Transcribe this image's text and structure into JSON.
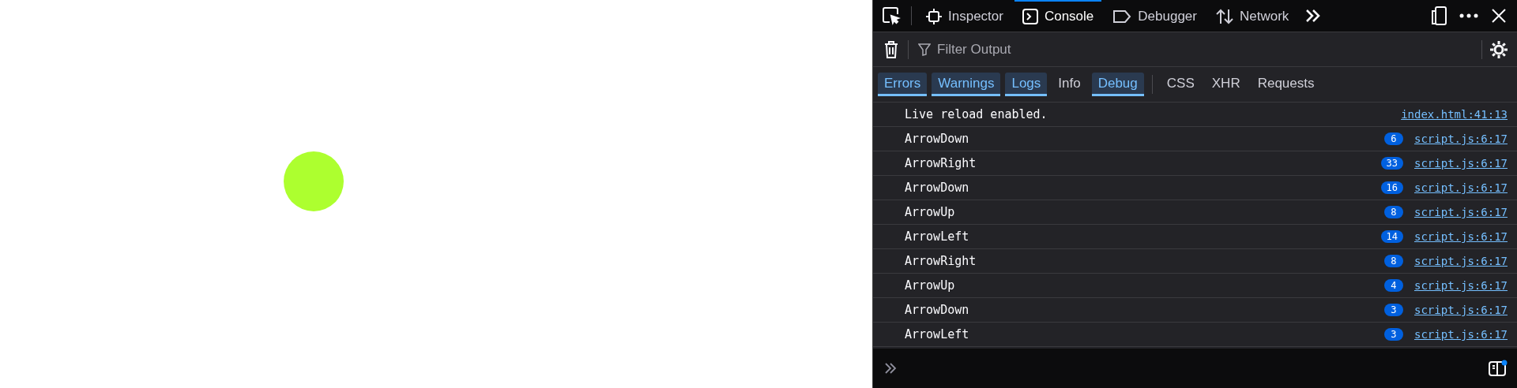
{
  "page": {
    "ball": {
      "color": "#adff2f"
    }
  },
  "devtools": {
    "tabs": [
      {
        "label": "Inspector",
        "kind": "inspector",
        "selected": false
      },
      {
        "label": "Console",
        "kind": "console",
        "selected": true
      },
      {
        "label": "Debugger",
        "kind": "debugger",
        "selected": false
      },
      {
        "label": "Network",
        "kind": "network",
        "selected": false
      }
    ],
    "filter": {
      "placeholder": "Filter Output"
    },
    "levels": [
      {
        "label": "Errors",
        "selected": true
      },
      {
        "label": "Warnings",
        "selected": true
      },
      {
        "label": "Logs",
        "selected": true
      },
      {
        "label": "Info",
        "selected": false
      },
      {
        "label": "Debug",
        "selected": true
      }
    ],
    "categories": [
      {
        "label": "CSS",
        "selected": false
      },
      {
        "label": "XHR",
        "selected": false
      },
      {
        "label": "Requests",
        "selected": false
      }
    ],
    "messages": [
      {
        "text": "Live reload enabled.",
        "source": "index.html:41:13"
      },
      {
        "text": "ArrowDown",
        "count": "6",
        "source": "script.js:6:17"
      },
      {
        "text": "ArrowRight",
        "count": "33",
        "source": "script.js:6:17"
      },
      {
        "text": "ArrowDown",
        "count": "16",
        "source": "script.js:6:17"
      },
      {
        "text": "ArrowUp",
        "count": "8",
        "source": "script.js:6:17"
      },
      {
        "text": "ArrowLeft",
        "count": "14",
        "source": "script.js:6:17"
      },
      {
        "text": "ArrowRight",
        "count": "8",
        "source": "script.js:6:17"
      },
      {
        "text": "ArrowUp",
        "count": "4",
        "source": "script.js:6:17"
      },
      {
        "text": "ArrowDown",
        "count": "3",
        "source": "script.js:6:17"
      },
      {
        "text": "ArrowLeft",
        "count": "3",
        "source": "script.js:6:17"
      }
    ]
  }
}
